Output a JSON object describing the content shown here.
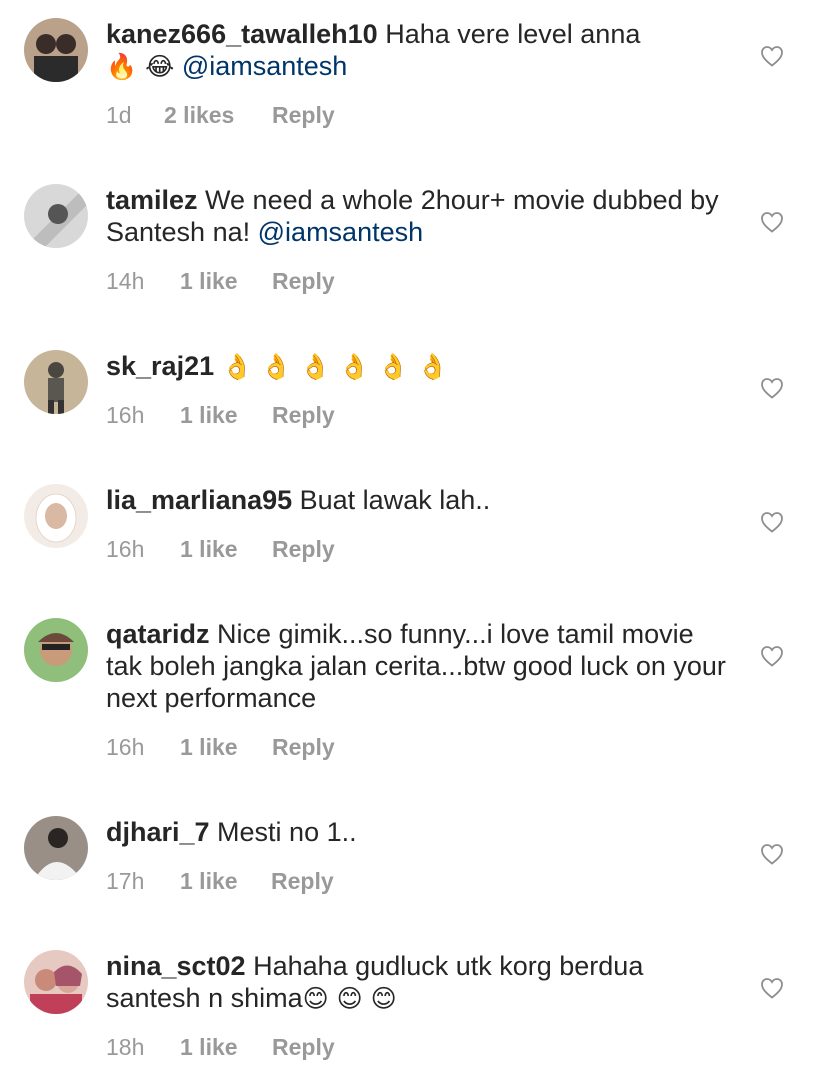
{
  "comments": [
    {
      "username": "kanez666_tawalleh10",
      "text_before": " Haha vere level anna",
      "emojis_inline": "🔥 😂",
      "mention": "@iamsantesh",
      "time": "1d",
      "likes": "2 likes",
      "reply": "Reply",
      "avatar_colors": [
        "#b9a18a",
        "#3a2c28"
      ]
    },
    {
      "username": "tamilez",
      "text_before": " We need a whole 2hour+ movie dubbed by Santesh na!",
      "mention": "@iamsantesh",
      "time": "14h",
      "likes": "1 like",
      "reply": "Reply",
      "avatar_colors": [
        "#d8d8d8",
        "#555555"
      ]
    },
    {
      "username": "sk_raj21",
      "text_before": " ",
      "emojis_inline": "👌 👌 👌 👌 👌 👌",
      "time": "16h",
      "likes": "1 like",
      "reply": "Reply",
      "avatar_colors": [
        "#c7b59a",
        "#4a4640"
      ]
    },
    {
      "username": "lia_marliana95",
      "text_before": " Buat lawak lah..",
      "time": "16h",
      "likes": "1 like",
      "reply": "Reply",
      "avatar_colors": [
        "#f3ece6",
        "#d9b9a3"
      ]
    },
    {
      "username": "qataridz",
      "text_before": " Nice gimik...so funny...i love tamil movie tak boleh jangka jalan cerita...btw good luck on your next performance",
      "time": "16h",
      "likes": "1 like",
      "reply": "Reply",
      "avatar_colors": [
        "#8fbf7a",
        "#6b4a3a"
      ]
    },
    {
      "username": "djhari_7",
      "text_before": " Mesti no 1..",
      "time": "17h",
      "likes": "1 like",
      "reply": "Reply",
      "avatar_colors": [
        "#9a8f86",
        "#2a2523"
      ]
    },
    {
      "username": "nina_sct02",
      "text_before": " Hahaha gudluck utk korg berdua santesh n shima",
      "emojis_inline": "😊 😊 😊",
      "time": "18h",
      "likes": "1 like",
      "reply": "Reply",
      "avatar_colors": [
        "#e6c9c0",
        "#a5546a"
      ]
    }
  ],
  "colors": {
    "text": "#262626",
    "mention": "#003569",
    "meta": "#999999",
    "heart_outline": "#8e8e8e"
  },
  "icons": {
    "like": "heart-outline-icon"
  }
}
